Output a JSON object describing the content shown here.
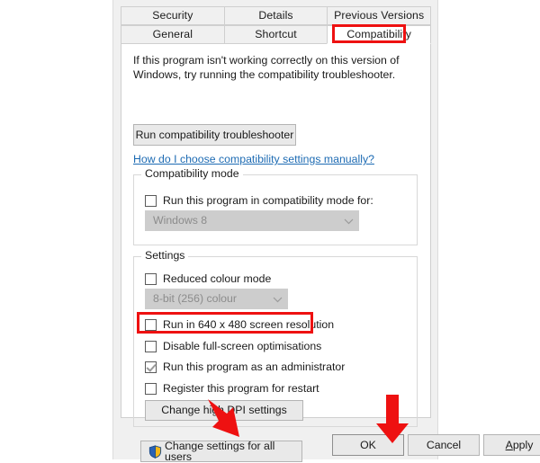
{
  "dialog": {
    "tabs_row_top": [
      {
        "label": "Security",
        "active": false
      },
      {
        "label": "Details",
        "active": false
      },
      {
        "label": "Previous Versions",
        "active": false
      }
    ],
    "tabs_row_bottom": [
      {
        "label": "General",
        "active": false
      },
      {
        "label": "Shortcut",
        "active": false
      },
      {
        "label": "Compatibility",
        "active": true
      }
    ],
    "intro_text": "If this program isn't working correctly on this version of Windows, try running the compatibility troubleshooter.",
    "troubleshoot_button": "Run compatibility troubleshooter",
    "help_link": "How do I choose compatibility settings manually?",
    "compatibility_mode": {
      "group_title": "Compatibility mode",
      "checkbox_label": "Run this program in compatibility mode for:",
      "checkbox_checked": false,
      "os_select_value": "Windows 8",
      "os_select_enabled": false
    },
    "settings": {
      "group_title": "Settings",
      "reduced_colour_label": "Reduced colour mode",
      "reduced_colour_checked": false,
      "colour_depth_value": "8-bit (256) colour",
      "colour_depth_enabled": false,
      "low_res_label": "Run in 640 x 480 screen resolution",
      "low_res_checked": false,
      "disable_fullscreen_label": "Disable full-screen optimisations",
      "disable_fullscreen_checked": false,
      "run_as_admin_label": "Run this program as an administrator",
      "run_as_admin_checked": true,
      "register_restart_label": "Register this program for restart",
      "register_restart_checked": false,
      "dpi_button": "Change high DPI settings"
    },
    "all_users_button": "Change settings for all users",
    "footer": {
      "ok": "OK",
      "cancel": "Cancel",
      "apply_accel": "A",
      "apply_rest": "pply"
    }
  },
  "annotations": {
    "highlight_color": "#ee1111",
    "boxes": [
      {
        "target": "Compatibility tab"
      },
      {
        "target": "Run this program as an administrator checkbox"
      }
    ],
    "arrows": [
      {
        "target": "OK button",
        "direction": "down-right"
      },
      {
        "target": "Apply button",
        "direction": "down"
      }
    ]
  },
  "colors": {
    "dialog_background": "#f0f0f0",
    "panel_background": "#ffffff",
    "link": "#1d6bb3",
    "disabled_control": "#cdcdcd",
    "shield_blue": "#2a62b6",
    "shield_gold": "#f5b817"
  }
}
